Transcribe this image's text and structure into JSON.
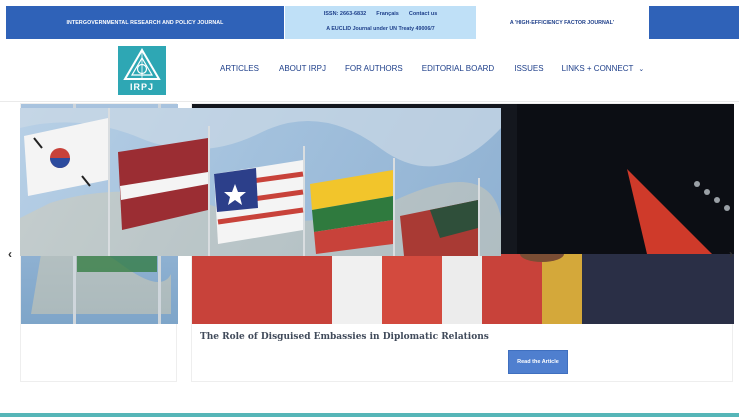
{
  "topbar": {
    "left_text": "INTERGOVERNMENTAL RESEARCH AND POLICY JOURNAL",
    "issn": "ISSN: 2663-6832",
    "francais": "Français",
    "contact": "Contact us",
    "treaty": "A EUCLID Journal under UN Treaty 49006/7",
    "right_text": "A 'HIGH-EFFICIENCY FACTOR JOURNAL'"
  },
  "logo": {
    "text": "IRPJ"
  },
  "nav": {
    "items": [
      {
        "label": "ARTICLES"
      },
      {
        "label": "ABOUT IRPJ"
      },
      {
        "label": "FOR AUTHORS"
      },
      {
        "label": "EDITORIAL BOARD"
      },
      {
        "label": "ISSUES"
      },
      {
        "label": "LINKS + CONNECT"
      }
    ],
    "chevron": "chevron-down-icon"
  },
  "slider": {
    "prev_arrow": "‹",
    "next_arrow": "›",
    "article_title": "The Role of Disguised Embassies in Diplomatic Relations",
    "read_button": "Read the Article"
  },
  "colors": {
    "brand_blue": "#2f62b8",
    "light_blue": "#bfe0f7",
    "teal": "#2ea7b4",
    "accent_line": "#56b6b8",
    "button_blue": "#4f7fcf"
  }
}
